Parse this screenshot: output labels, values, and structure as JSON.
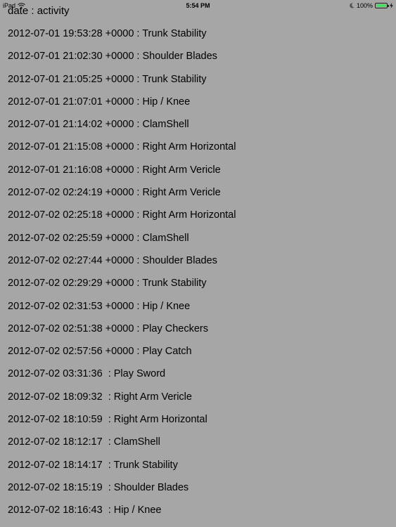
{
  "status_bar": {
    "carrier": "iPad",
    "time": "5:54 PM",
    "battery_percent": "100%",
    "battery_level": 1.0,
    "icons": {
      "wifi": "wifi-icon",
      "moon": "moon-icon",
      "battery": "battery-icon",
      "charging": "charging-icon"
    }
  },
  "header": {
    "title": "date : activity"
  },
  "log": [
    "2012-07-01 19:53:28 +0000 : Trunk Stability",
    "2012-07-01 21:02:30 +0000 : Shoulder Blades",
    "2012-07-01 21:05:25 +0000 : Trunk Stability",
    "2012-07-01 21:07:01 +0000 : Hip / Knee",
    "2012-07-01 21:14:02 +0000 : ClamShell",
    "2012-07-01 21:15:08 +0000 : Right Arm Horizontal",
    "2012-07-01 21:16:08 +0000 : Right Arm Vericle",
    "2012-07-02 02:24:19 +0000 : Right Arm Vericle",
    "2012-07-02 02:25:18 +0000 : Right Arm Horizontal",
    "2012-07-02 02:25:59 +0000 : ClamShell",
    "2012-07-02 02:27:44 +0000 : Shoulder Blades",
    "2012-07-02 02:29:29 +0000 : Trunk Stability",
    "2012-07-02 02:31:53 +0000 : Hip / Knee",
    "2012-07-02 02:51:38 +0000 : Play Checkers",
    "2012-07-02 02:57:56 +0000 : Play Catch",
    "2012-07-02 03:31:36  : Play Sword",
    "2012-07-02 18:09:32  : Right Arm Vericle",
    "2012-07-02 18:10:59  : Right Arm Horizontal",
    "2012-07-02 18:12:17  : ClamShell",
    "2012-07-02 18:14:17  : Trunk Stability",
    "2012-07-02 18:15:19  : Shoulder Blades",
    "2012-07-02 18:16:43  : Hip / Knee"
  ]
}
